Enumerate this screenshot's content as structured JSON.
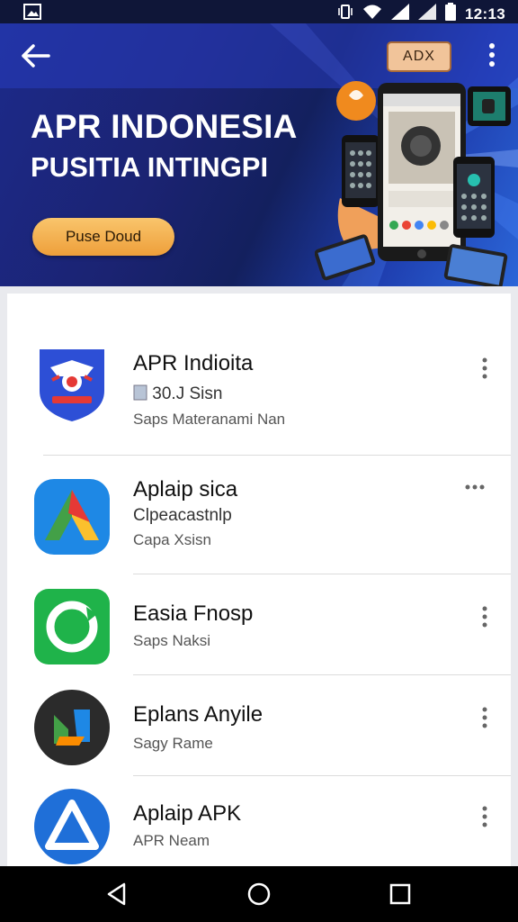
{
  "status_bar": {
    "time": "12:13"
  },
  "banner": {
    "title": "APR INDONESIA",
    "subtitle": "PUSITIA INTINGPI",
    "cta_label": "Puse Doud",
    "ad_label": "ADX"
  },
  "apps": [
    {
      "name": "APR Indioita",
      "line2": "30.J Sisn",
      "line3": "Saps Materanami Nan"
    },
    {
      "name": "Aplaip sica",
      "line2": "Clpeacastnlp",
      "line3": "Capa Xsisn"
    },
    {
      "name": "Easia Fnosp",
      "line2": "",
      "line3": "Saps Naksi"
    },
    {
      "name": "Eplans Anyile",
      "line2": "",
      "line3": "Sagy Rame"
    },
    {
      "name": "Aplaip APK",
      "line2": "",
      "line3": "APR Neam"
    }
  ],
  "icons": {
    "back": "arrow-back-icon",
    "overflow": "more-vert-icon",
    "nav_back": "triangle-back-icon",
    "nav_home": "circle-home-icon",
    "nav_recents": "square-recents-icon"
  },
  "colors": {
    "banner_dark": "#13205e",
    "banner_accent": "#2b66d8",
    "cta": "#f4b04f",
    "app_icon_1": "#2d4fd6",
    "app_icon_3": "#1fb34a",
    "app_icon_5": "#1f6fd8"
  }
}
